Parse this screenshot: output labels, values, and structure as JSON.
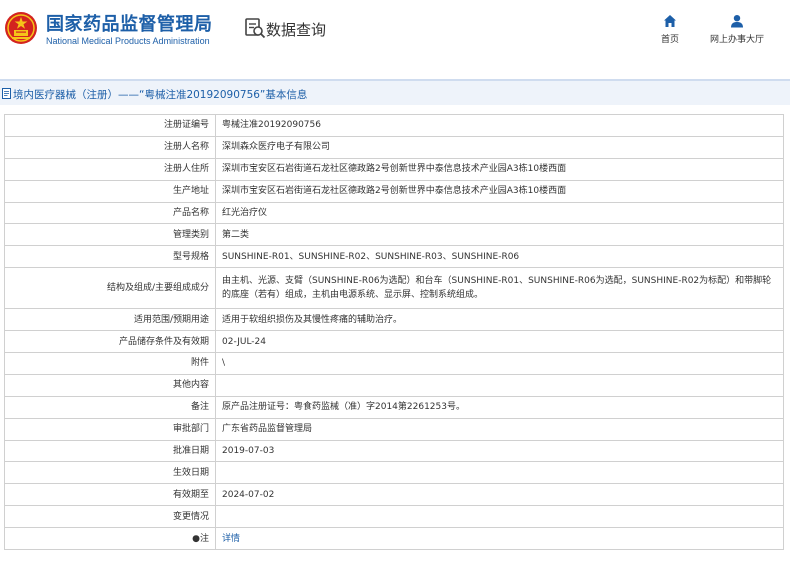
{
  "header": {
    "brand_cn": "国家药品监督管理局",
    "brand_en": "National Medical Products Administration",
    "query_title": "数据查询",
    "nav": [
      {
        "label": "首页",
        "icon": "home-icon"
      },
      {
        "label": "网上办事大厅",
        "icon": "user-icon"
      }
    ]
  },
  "titlebar": {
    "text": "境内医疗器械（注册）——“粤械注准20192090756”基本信息"
  },
  "rows": [
    {
      "label": "注册证编号",
      "value": "粤械注准20192090756"
    },
    {
      "label": "注册人名称",
      "value": "深圳森众医疗电子有限公司"
    },
    {
      "label": "注册人住所",
      "value": "深圳市宝安区石岩街道石龙社区德政路2号创新世界中泰信息技术产业园A3栋10楼西面"
    },
    {
      "label": "生产地址",
      "value": "深圳市宝安区石岩街道石龙社区德政路2号创新世界中泰信息技术产业园A3栋10楼西面"
    },
    {
      "label": "产品名称",
      "value": "红光治疗仪"
    },
    {
      "label": "管理类别",
      "value": "第二类"
    },
    {
      "label": "型号规格",
      "value": "SUNSHINE-R01、SUNSHINE-R02、SUNSHINE-R03、SUNSHINE-R06"
    },
    {
      "label": "结构及组成/主要组成成分",
      "value": "由主机、光源、支臂（SUNSHINE-R06为选配）和台车（SUNSHINE-R01、SUNSHINE-R06为选配，SUNSHINE-R02为标配）和带脚轮的底座（若有）组成，主机由电源系统、显示屏、控制系统组成。"
    },
    {
      "label": "适用范围/预期用途",
      "value": "适用于软组织损伤及其慢性疼痛的辅助治疗。"
    },
    {
      "label": "产品储存条件及有效期",
      "value": "02-JUL-24"
    },
    {
      "label": "附件",
      "value": "\\"
    },
    {
      "label": "其他内容",
      "value": ""
    },
    {
      "label": "备注",
      "value": "原产品注册证号：粤食药监械（准）字2014第2261253号。"
    },
    {
      "label": "审批部门",
      "value": "广东省药品监督管理局"
    },
    {
      "label": "批准日期",
      "value": "2019-07-03"
    },
    {
      "label": "生效日期",
      "value": ""
    },
    {
      "label": "有效期至",
      "value": "2024-07-02"
    },
    {
      "label": "变更情况",
      "value": ""
    },
    {
      "label": "注",
      "value": "详情",
      "label_icon": "bulb-icon"
    }
  ],
  "colors": {
    "brand_blue": "#1d5fa8",
    "titlebar_bg": "#eef3fa",
    "border": "#d0d0d0"
  }
}
